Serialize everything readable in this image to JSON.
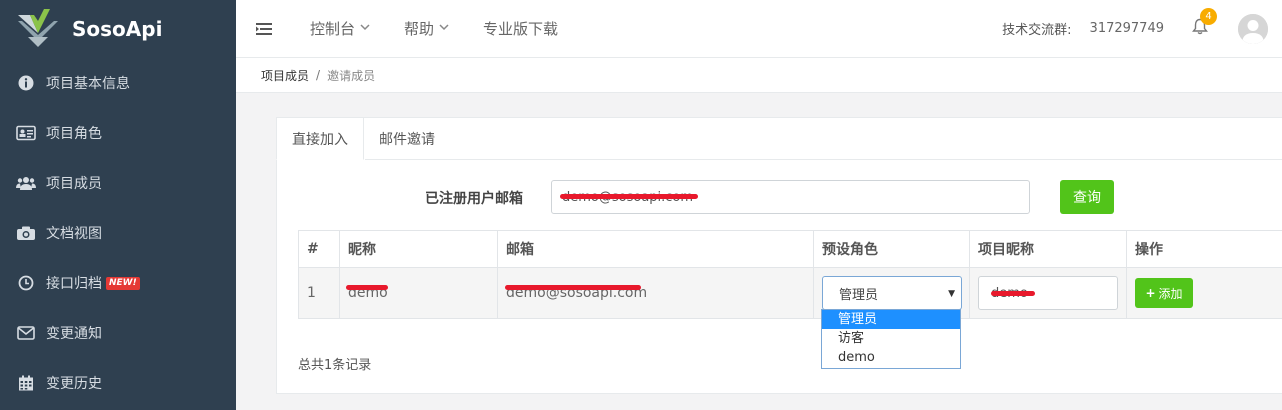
{
  "app": {
    "logo_text": "SosoApi"
  },
  "sidebar": {
    "items": [
      {
        "label": "项目基本信息",
        "icon": "info-icon"
      },
      {
        "label": "项目角色",
        "icon": "id-card-icon"
      },
      {
        "label": "项目成员",
        "icon": "users-icon"
      },
      {
        "label": "文档视图",
        "icon": "camera-icon"
      },
      {
        "label": "接口归档",
        "icon": "clock-icon",
        "badge": "NEW!"
      },
      {
        "label": "变更通知",
        "icon": "envelope-icon"
      },
      {
        "label": "变更历史",
        "icon": "calendar-icon"
      }
    ]
  },
  "topbar": {
    "links": [
      "控制台",
      "帮助",
      "专业版下载"
    ],
    "group_label": "技术交流群:",
    "group_number": "317297749",
    "notification_count": "4"
  },
  "breadcrumb": {
    "parent": "项目成员",
    "separator": "/",
    "current": "邀请成员"
  },
  "tabs": [
    "直接加入",
    "邮件邀请"
  ],
  "search": {
    "label": "已注册用户邮箱",
    "value": "demo@sosoapi.com",
    "button": "查询"
  },
  "table": {
    "headers": [
      "#",
      "昵称",
      "邮箱",
      "预设角色",
      "项目昵称",
      "操作"
    ],
    "rows": [
      {
        "index": "1",
        "nickname": "demo",
        "email": "demo@sosoapi.com",
        "role": "管理员",
        "project_nickname": "demo",
        "action": "添加"
      }
    ]
  },
  "role_options": [
    "管理员",
    "访客",
    "demo"
  ],
  "footer": {
    "count_text": "总共1条记录"
  },
  "colors": {
    "sidebar_bg": "#2f4050",
    "accent_green": "#52c41a",
    "redaction": "#e8192c",
    "select_highlight": "#1e90ff"
  }
}
